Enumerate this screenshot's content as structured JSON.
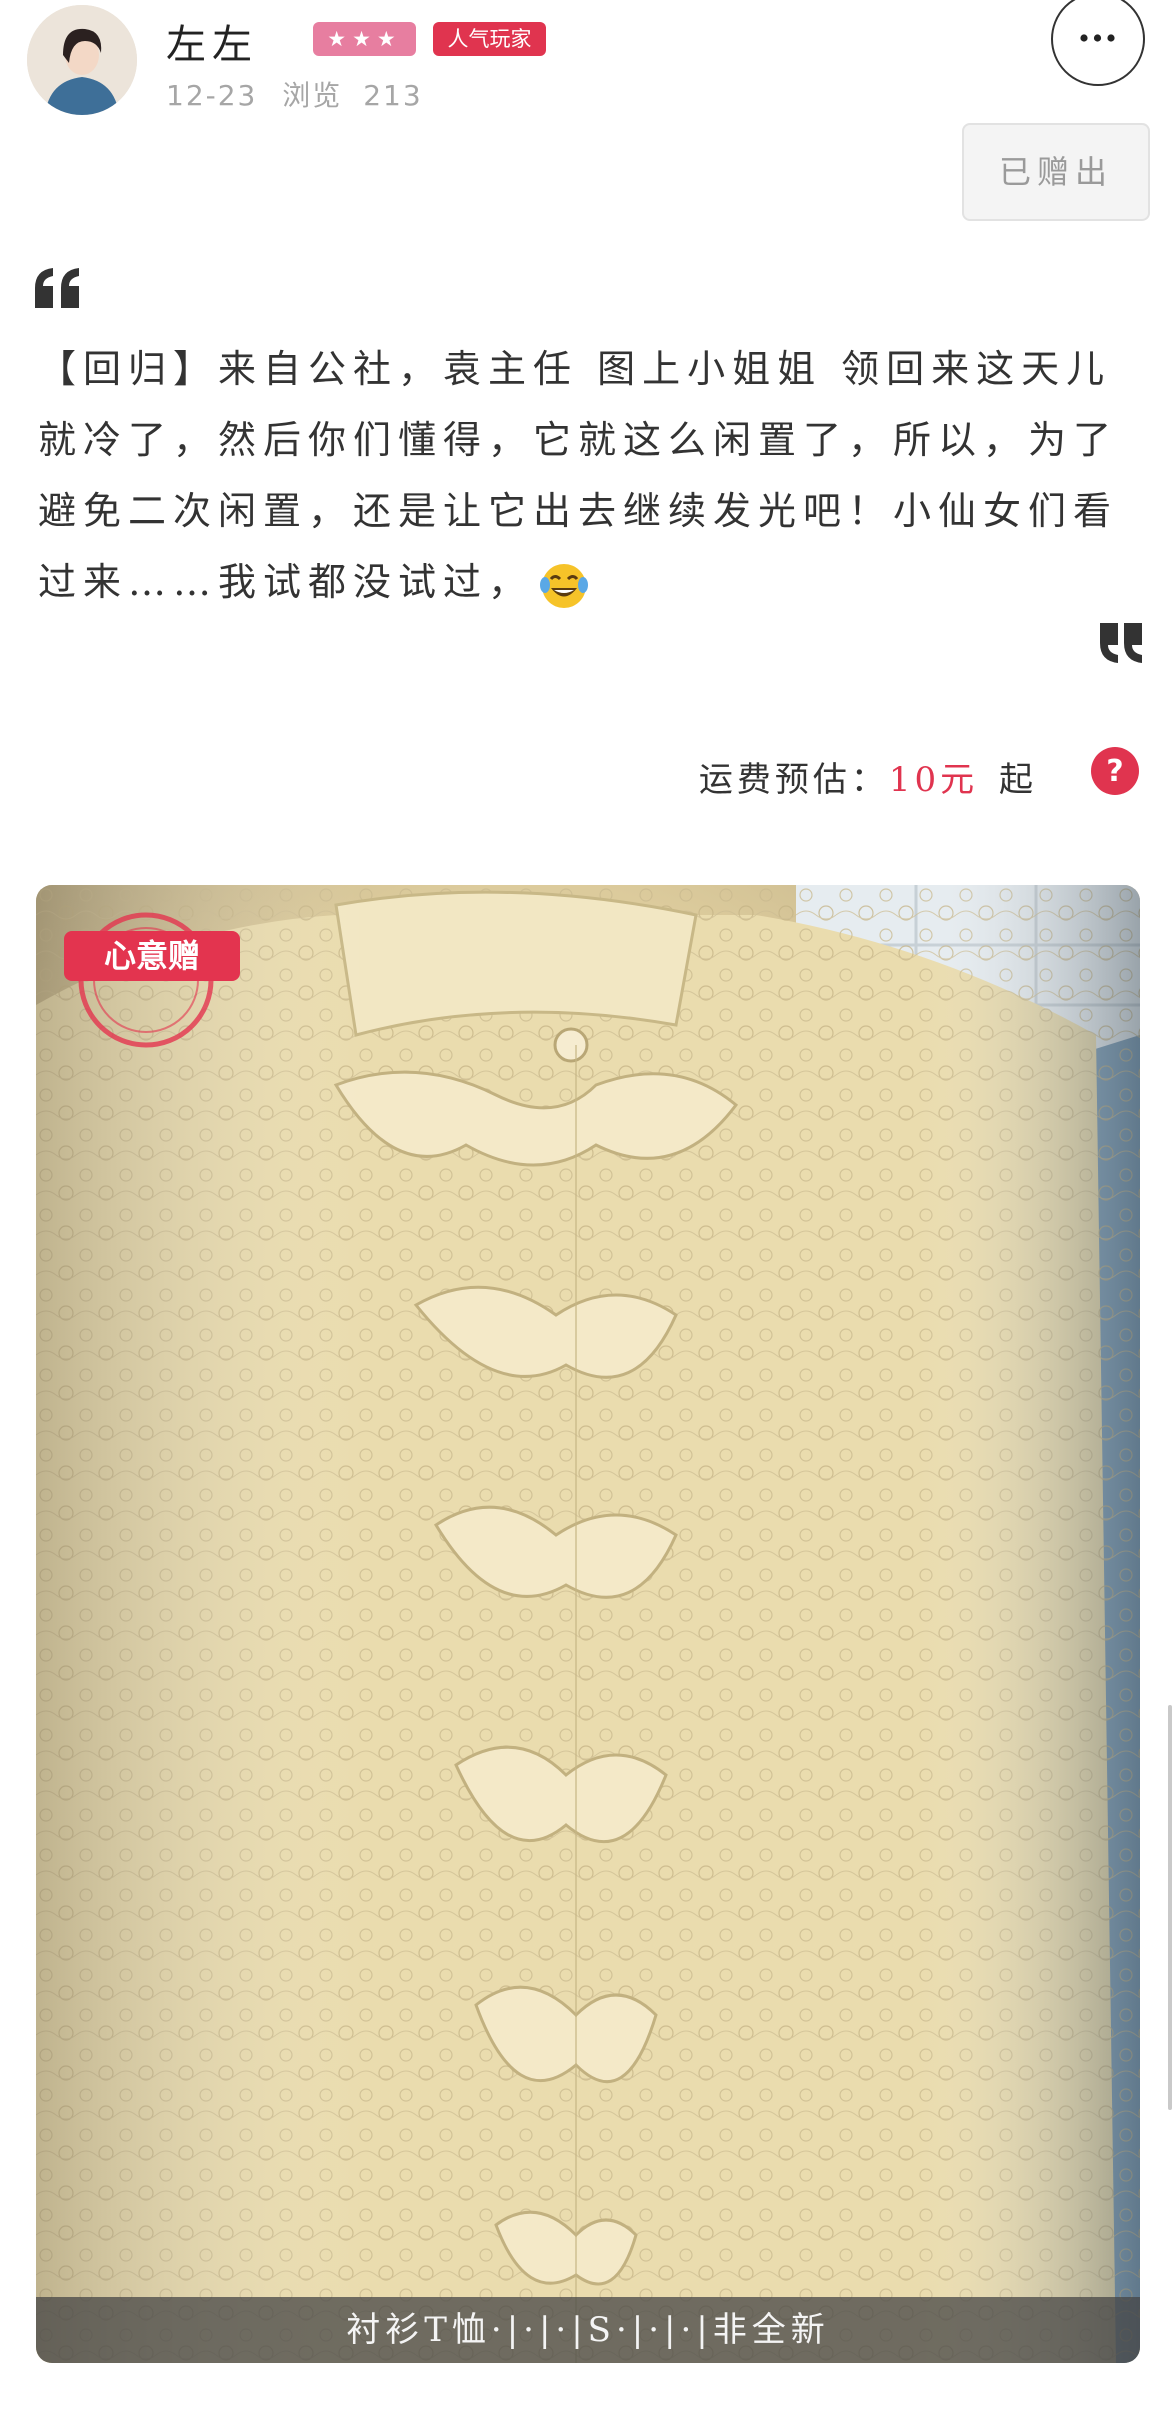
{
  "post": {
    "username": "左左",
    "stars_badge": "★★★",
    "popular_badge": "人气玩家",
    "date": "12-23",
    "views_label": "浏览",
    "views": "213",
    "status_button": "已赠出",
    "body": "【回归】来自公社，袁主任 图上小姐姐 领回来这天儿就冷了，然后你们懂得，它就这么闲置了，所以，为了避免二次闲置，还是让它出去继续发光吧！小仙女们看过来……我试都没试过，",
    "emoji": "tears-of-joy-emoji"
  },
  "shipping": {
    "label": "运费预估：",
    "price": "10元",
    "suffix": "起"
  },
  "photo": {
    "badge": "心意赠",
    "caption": "衬衫T恤·|·|·|S·|·|·|非全新"
  },
  "icons": {
    "more": "more-icon",
    "help": "help-icon",
    "quote_open": "quote-open-icon",
    "quote_close": "quote-close-icon"
  },
  "colors": {
    "accent_red": "#e0344f",
    "star_pink": "#e77ea0"
  }
}
